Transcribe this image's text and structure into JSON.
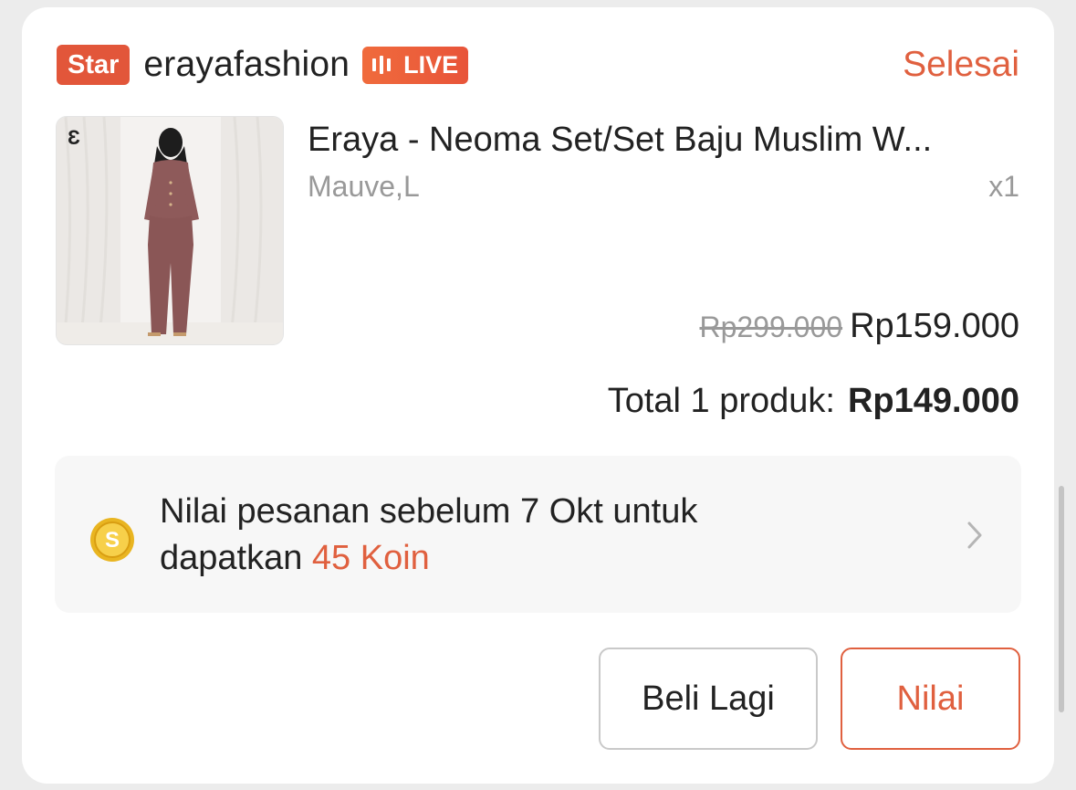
{
  "shop": {
    "badge": "Star",
    "name": "erayafashion",
    "live_label": "LIVE",
    "status": "Selesai"
  },
  "product": {
    "image_icon": "product-photo",
    "brand_mark": "Ɛ",
    "name": "Eraya - Neoma Set/Set Baju Muslim W...",
    "variant": "Mauve,L",
    "quantity": "x1",
    "original_price": "Rp299.000",
    "price": "Rp159.000"
  },
  "total": {
    "label": "Total 1 produk:",
    "amount": "Rp149.000"
  },
  "coins": {
    "icon": "coin-icon",
    "line1": "Nilai pesanan sebelum 7 Okt untuk",
    "line2_prefix": "dapatkan ",
    "line2_highlight": "45 Koin"
  },
  "actions": {
    "buy_again": "Beli Lagi",
    "rate": "Nilai"
  },
  "colors": {
    "accent": "#e0603f",
    "badge": "#e2563a"
  }
}
